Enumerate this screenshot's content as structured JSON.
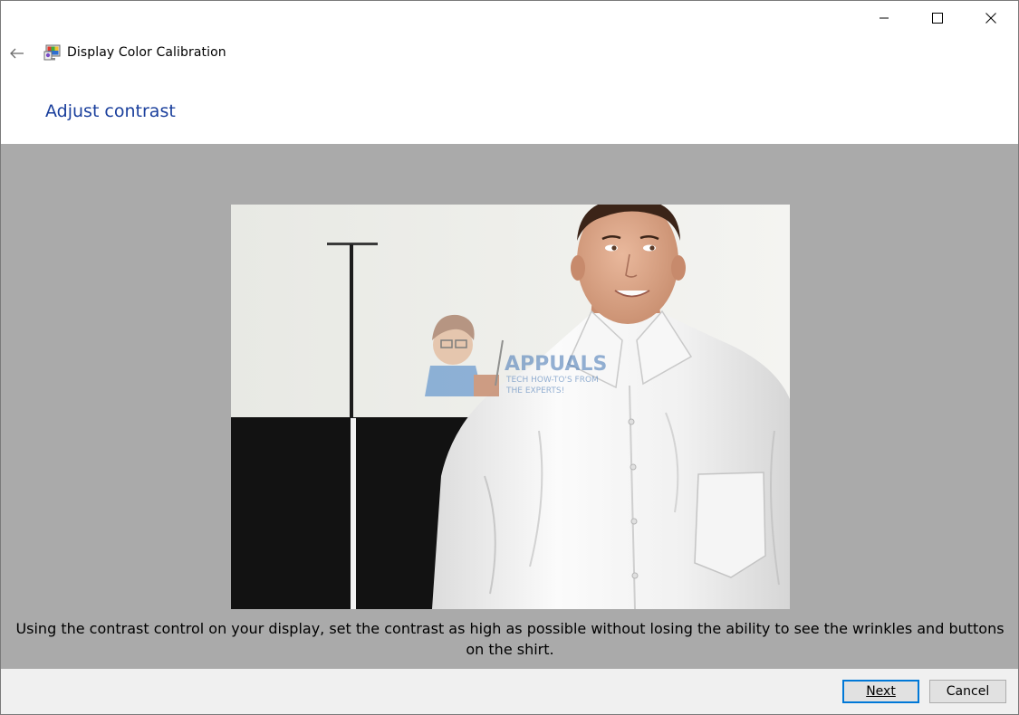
{
  "window": {
    "title": "Display Color Calibration",
    "controls": {
      "minimize_icon": "minimize-icon",
      "maximize_icon": "maximize-icon",
      "close_icon": "close-icon"
    }
  },
  "nav": {
    "back_icon": "back-arrow-icon",
    "app_icon": "display-color-calibration-icon"
  },
  "page": {
    "heading": "Adjust contrast",
    "instruction": "Using the contrast control on your display, set the contrast as high as possible without losing the ability to see the wrinkles and buttons on the shirt."
  },
  "image": {
    "watermark_title": "APPUALS",
    "watermark_subtitle_1": "TECH HOW-TO'S FROM",
    "watermark_subtitle_2": "THE EXPERTS!"
  },
  "buttons": {
    "next_label": "Next",
    "cancel_label": "Cancel"
  },
  "colors": {
    "heading": "#1a3f9c",
    "content_background": "#aaaaaa",
    "footer_background": "#f0f0f0",
    "default_button_border": "#0078d7"
  }
}
